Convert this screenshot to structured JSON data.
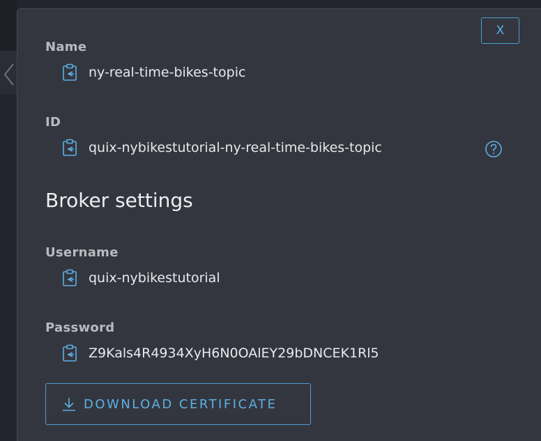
{
  "dialog": {
    "close_label": "X",
    "section_title": "Broker settings",
    "download_label": "DOWNLOAD CERTIFICATE"
  },
  "fields": {
    "name": {
      "label": "Name",
      "value": "ny-real-time-bikes-topic"
    },
    "id": {
      "label": "ID",
      "value": "quix-nybikestutorial-ny-real-time-bikes-topic"
    },
    "username": {
      "label": "Username",
      "value": "quix-nybikestutorial"
    },
    "password": {
      "label": "Password",
      "value": "Z9Kals4R4934XyH6N0OAlEY29bDNCEK1Rl5"
    }
  },
  "icons": {
    "copy": "clipboard-copy-icon",
    "help": "help-circle-icon",
    "download": "download-icon",
    "back": "chevron-left-icon"
  },
  "colors": {
    "panel_bg": "#34363f",
    "accent": "#5cb0e4",
    "label": "#b8bac0",
    "value": "#e8e9ec"
  }
}
